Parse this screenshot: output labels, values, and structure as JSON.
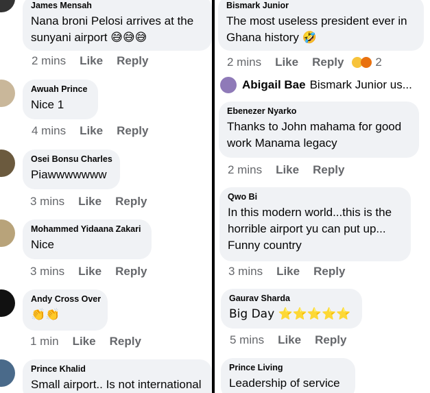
{
  "left": [
    {
      "name": "James Mensah",
      "text": "Nana broni Pelosi arrives at the sunyani airport 😅😅😅",
      "time": "2 mins",
      "like": "Like",
      "reply": "Reply"
    },
    {
      "name": "Awuah Prince",
      "text": "Nice 1",
      "time": "4 mins",
      "like": "Like",
      "reply": "Reply"
    },
    {
      "name": "Osei Bonsu Charles",
      "text": "Piawwwwwww",
      "time": "3 mins",
      "like": "Like",
      "reply": "Reply"
    },
    {
      "name": "Mohammed Yidaana Zakari",
      "text": "Nice",
      "time": "3 mins",
      "like": "Like",
      "reply": "Reply"
    },
    {
      "name": "Andy Cross Over",
      "text": "👏👏",
      "time": "1 min",
      "like": "Like",
      "reply": "Reply"
    },
    {
      "name": "Prince Khalid",
      "text": "Small airport.. Is not international"
    }
  ],
  "right": [
    {
      "name": "Bismark Junior",
      "text": "The most useless president ever in Ghana history 🤣",
      "time": "2 mins",
      "like": "Like",
      "reply": "Reply",
      "reaction_count": "2"
    },
    {
      "name": "Ebenezer Nyarko",
      "text": "Thanks to John mahama for good work Manama legacy",
      "time": "2 mins",
      "like": "Like",
      "reply": "Reply"
    },
    {
      "name": "Qwo Bi",
      "text": "In this modern world...this is the horrible airport yu can put up... Funny country",
      "time": "3 mins",
      "like": "Like",
      "reply": "Reply"
    },
    {
      "name": "Gaurav Sharda",
      "text": "Big Day ⭐⭐⭐⭐⭐",
      "time": "5 mins",
      "like": "Like",
      "reply": "Reply"
    },
    {
      "name": "Prince Living",
      "text": "Leadership of service"
    }
  ],
  "reply_preview": {
    "name": "Abigail Bae",
    "text": "Bismark Junior us..."
  },
  "colors": {
    "bubble": "#f0f2f5",
    "secondary_text": "#65676b",
    "divider": "#000000"
  }
}
